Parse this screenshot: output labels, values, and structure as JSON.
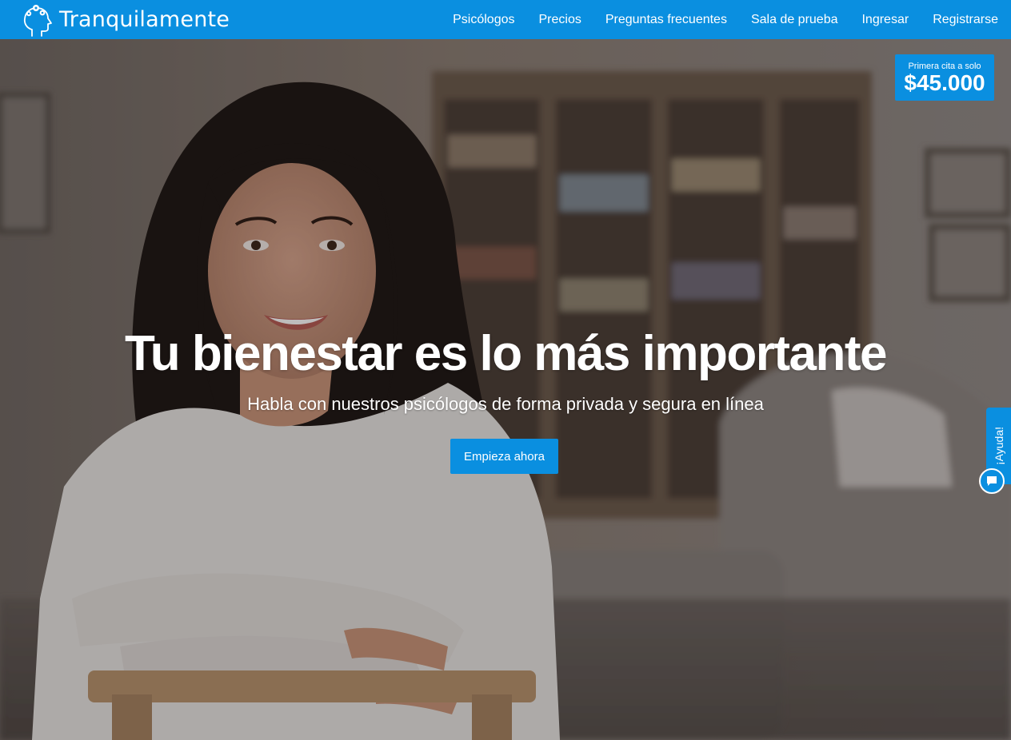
{
  "brand": {
    "name": "Tranquilamente",
    "logo_icon": "head-gears-icon"
  },
  "nav": {
    "items": [
      {
        "label": "Psicólogos"
      },
      {
        "label": "Precios"
      },
      {
        "label": "Preguntas frecuentes"
      },
      {
        "label": "Sala de prueba"
      },
      {
        "label": "Ingresar"
      },
      {
        "label": "Registrarse"
      }
    ]
  },
  "promo": {
    "caption": "Primera cita a solo",
    "price": "$45.000"
  },
  "hero": {
    "title": "Tu bienestar es lo más importante",
    "subtitle": "Habla con nuestros psicólogos de forma privada y segura en línea",
    "cta_label": "Empieza ahora"
  },
  "help": {
    "tab_label": "¡Ayuda!",
    "chat_icon": "chat-bubble-icon"
  },
  "colors": {
    "primary": "#0a8fe0",
    "text_on_primary": "#ffffff"
  }
}
